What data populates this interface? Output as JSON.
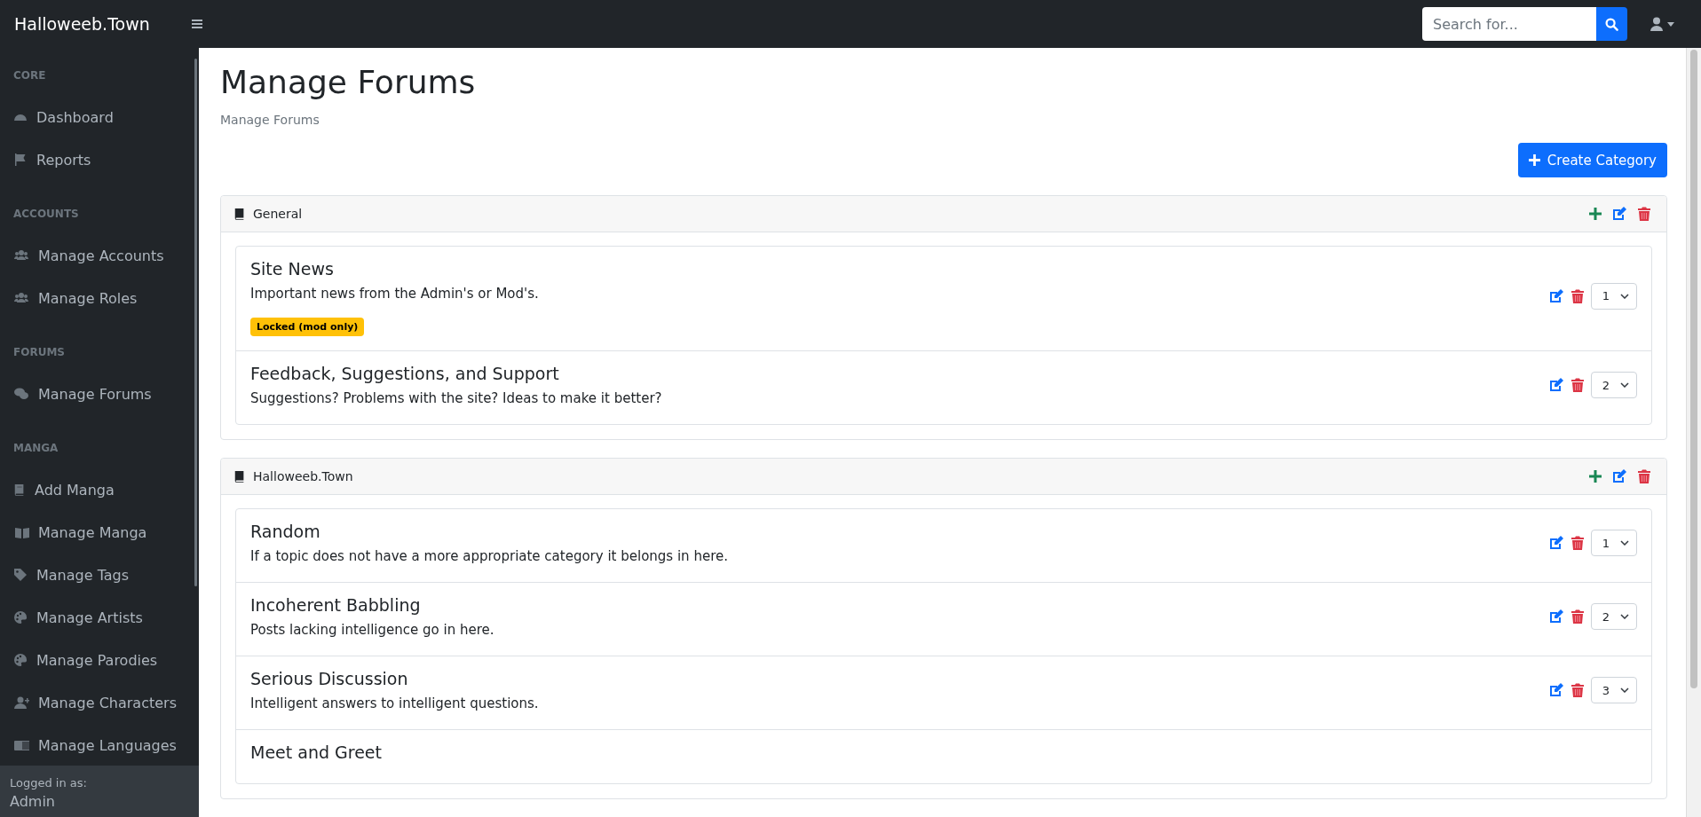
{
  "brand": "Halloweeb.Town",
  "search": {
    "placeholder": "Search for..."
  },
  "sidebar": {
    "sections": [
      {
        "heading": "CORE",
        "items": [
          {
            "label": "Dashboard",
            "selected": false
          },
          {
            "label": "Reports",
            "selected": false
          }
        ]
      },
      {
        "heading": "ACCOUNTS",
        "items": [
          {
            "label": "Manage Accounts",
            "selected": false
          },
          {
            "label": "Manage Roles",
            "selected": false
          }
        ]
      },
      {
        "heading": "FORUMS",
        "items": [
          {
            "label": "Manage Forums",
            "selected": false
          }
        ]
      },
      {
        "heading": "MANGA",
        "items": [
          {
            "label": "Add Manga",
            "selected": false
          },
          {
            "label": "Manage Manga",
            "selected": false
          },
          {
            "label": "Manage Tags",
            "selected": false
          },
          {
            "label": "Manage Artists",
            "selected": false
          },
          {
            "label": "Manage Parodies",
            "selected": false
          },
          {
            "label": "Manage Characters",
            "selected": false
          },
          {
            "label": "Manage Languages",
            "selected": false
          }
        ]
      }
    ],
    "footer": {
      "caption": "Logged in as:",
      "user": "Admin"
    }
  },
  "page": {
    "title": "Manage Forums",
    "breadcrumb": "Manage Forums",
    "create_button": "Create Category"
  },
  "categories": [
    {
      "name": "General",
      "forums": [
        {
          "name": "Site News",
          "description": "Important news from the Admin's or Mod's.",
          "badge": "Locked (mod only)",
          "order": "1"
        },
        {
          "name": "Feedback, Suggestions, and Support",
          "description": "Suggestions? Problems with the site? Ideas to make it better?",
          "order": "2"
        }
      ]
    },
    {
      "name": "Halloweeb.Town",
      "forums": [
        {
          "name": "Random",
          "description": "If a topic does not have a more appropriate category it belongs in here.",
          "order": "1"
        },
        {
          "name": "Incoherent Babbling",
          "description": "Posts lacking intelligence go in here.",
          "order": "2"
        },
        {
          "name": "Serious Discussion",
          "description": "Intelligent answers to intelligent questions.",
          "order": "3"
        },
        {
          "name": "Meet and Greet"
        }
      ]
    }
  ]
}
